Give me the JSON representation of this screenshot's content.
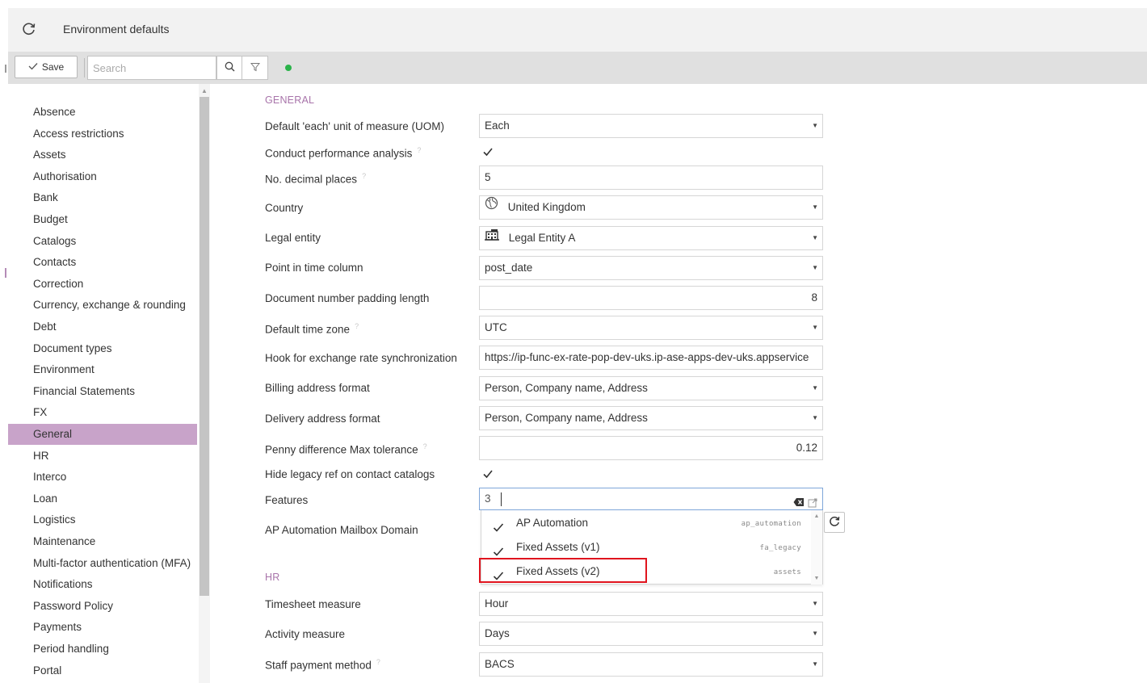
{
  "window": {
    "title": "Environment defaults"
  },
  "toolbar": {
    "save_label": "Save",
    "search_placeholder": "Search",
    "status_color": "#2bb34a"
  },
  "sidebar": {
    "active_index": 15,
    "items": [
      "Absence",
      "Access restrictions",
      "Assets",
      "Authorisation",
      "Bank",
      "Budget",
      "Catalogs",
      "Contacts",
      "Correction",
      "Currency, exchange & rounding",
      "Debt",
      "Document types",
      "Environment",
      "Financial Statements",
      "FX",
      "General",
      "HR",
      "Interco",
      "Loan",
      "Logistics",
      "Maintenance",
      "Multi-factor authentication (MFA)",
      "Notifications",
      "Password Policy",
      "Payments",
      "Period handling",
      "Portal"
    ]
  },
  "sections": {
    "general": "GENERAL",
    "hr": "HR"
  },
  "fields": {
    "default_uom": {
      "label": "Default 'each' unit of measure (UOM)",
      "value": "Each"
    },
    "perf_analysis": {
      "label": "Conduct performance analysis",
      "help": "?",
      "checked": true
    },
    "decimal_places": {
      "label": "No. decimal places",
      "help": "?",
      "value": "5"
    },
    "country": {
      "label": "Country",
      "value": "United Kingdom",
      "icon": "globe-icon"
    },
    "legal_entity": {
      "label": "Legal entity",
      "value": "Legal Entity A",
      "icon": "building-icon"
    },
    "point_in_time": {
      "label": "Point in time column",
      "value": "post_date"
    },
    "doc_padding": {
      "label": "Document number padding length",
      "value": "8"
    },
    "time_zone": {
      "label": "Default time zone",
      "help": "?",
      "value": "UTC"
    },
    "exchange_hook": {
      "label": "Hook for exchange rate synchronization",
      "value": "https://ip-func-ex-rate-pop-dev-uks.ip-ase-apps-dev-uks.appservice"
    },
    "billing_format": {
      "label": "Billing address format",
      "value": "Person, Company name, Address"
    },
    "delivery_format": {
      "label": "Delivery address format",
      "value": "Person, Company name, Address"
    },
    "penny_tolerance": {
      "label": "Penny difference Max tolerance",
      "help": "?",
      "value": "0.12"
    },
    "hide_legacy_ref": {
      "label": "Hide legacy ref on contact catalogs",
      "checked": true
    },
    "features": {
      "label": "Features",
      "count": "3"
    },
    "mailbox_domain": {
      "label": "AP Automation Mailbox Domain"
    },
    "timesheet_measure": {
      "label": "Timesheet measure",
      "value": "Hour"
    },
    "activity_measure": {
      "label": "Activity measure",
      "value": "Days"
    },
    "staff_payment": {
      "label": "Staff payment method",
      "help": "?",
      "value": "BACS"
    }
  },
  "features_options": [
    {
      "label": "AP Automation",
      "code": "ap_automation",
      "checked": true
    },
    {
      "label": "Fixed Assets (v1)",
      "code": "fa_legacy",
      "checked": true
    },
    {
      "label": "Fixed Assets (v2)",
      "code": "assets",
      "checked": true,
      "highlighted": true
    }
  ],
  "colors": {
    "accent": "#a874aa",
    "active_sidebar": "#c8a3c9",
    "highlight": "#e0141e"
  }
}
